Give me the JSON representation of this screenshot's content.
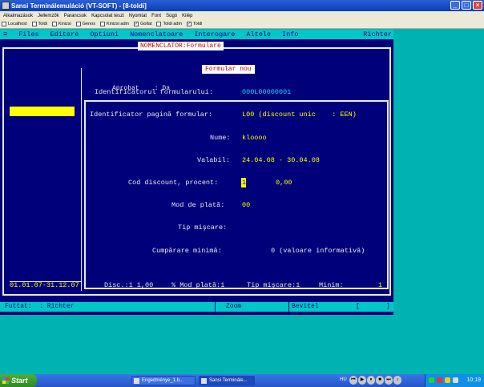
{
  "window": {
    "title": "Sansi Terminálemuláció (VT-SOFT) - [8-toldi]",
    "buttons": [
      "_",
      "□",
      "×"
    ]
  },
  "menubar": [
    "Alkalmazások",
    "Jellemzők",
    "Parancsok",
    "Kapcsolat teszt",
    "Nyomtat",
    "Font",
    "Súgó",
    "Kilép"
  ],
  "checkbar": [
    {
      "label": "Localhost",
      "checked": false
    },
    {
      "label": "Toldi",
      "checked": false
    },
    {
      "label": "Kinizsi",
      "checked": false
    },
    {
      "label": "Genos",
      "checked": false
    },
    {
      "label": "Kinizsi adm",
      "checked": false
    },
    {
      "label": "Gollat",
      "checked": true
    },
    {
      "label": "Toldi adm",
      "checked": false
    },
    {
      "label": "Toldi",
      "checked": true
    }
  ],
  "terminal": {
    "menu": [
      "≡",
      "Files",
      "Editare",
      "Optiuni",
      "Nomenclatoare",
      "Interogare",
      "Altele",
      "Info"
    ],
    "menu_right": "Richter",
    "frame_title": "NOMENCLATOR:Formulare",
    "aprobat": "Aprobat    : Da",
    "inner_title": "Formular nou",
    "fields": {
      "id_label": "Identificatorul formularului:",
      "id_value": "000L00000001",
      "page_label": "Identificator pagină formular:",
      "page_value": "L00 (discount unic    : EEN)",
      "nume_label": "Nume:",
      "nume_value": "kloooo",
      "valabil_label": "Valabil:",
      "valabil_value": "24.04.08 - 30.04.08",
      "cod_label": "Cod discount, procent:",
      "cod_value": "1",
      "procent_value": "0,00",
      "mod_label": "Mod de plată:",
      "mod_value": "00",
      "tip_label": "Tip mişcare:",
      "cump_label": "Cumpărare minimă:",
      "cump_value": "0 (valoare informativă)"
    },
    "status": {
      "period": "01.01.07-31.12.07",
      "disc": "Disc.:1 1,00",
      "mod": "% Mod plată:1",
      "tip": "Tip mişcare:1",
      "minim": "Minim:",
      "minim_value": "1"
    },
    "bottom": {
      "futtat": "Futtat:  : Richter",
      "zoom": "Zoom",
      "bevitel": "Bevitel",
      "bracket_l": "[",
      "bracket_r": "]"
    }
  },
  "taskbar": {
    "start": "Start",
    "tasks": [
      "Engedménye_1.b...",
      "Sansi Terminále..."
    ],
    "lang": "HU",
    "clock": "10:19"
  }
}
